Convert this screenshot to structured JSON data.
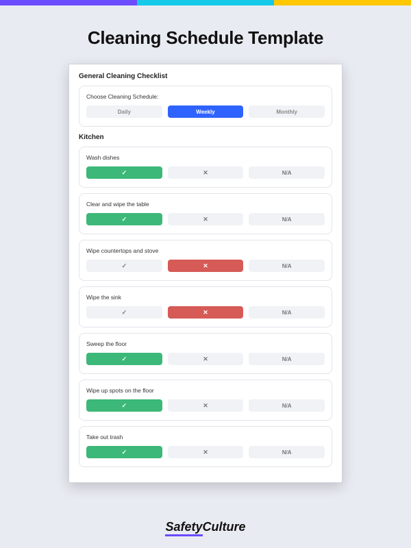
{
  "page": {
    "title": "Cleaning Schedule Template"
  },
  "card": {
    "heading": "General Cleaning Checklist",
    "schedule": {
      "label": "Choose Cleaning Schedule:",
      "options": [
        "Daily",
        "Weekly",
        "Monthly"
      ],
      "selected": "Weekly"
    },
    "section": "Kitchen",
    "option_labels": {
      "check": "✓",
      "cross": "✕",
      "na": "N/A"
    },
    "tasks": [
      {
        "title": "Wash dishes",
        "selected": "check"
      },
      {
        "title": "Clear and wipe the table",
        "selected": "check"
      },
      {
        "title": "Wipe countertops and stove",
        "selected": "cross"
      },
      {
        "title": "Wipe the sink",
        "selected": "cross"
      },
      {
        "title": "Sweep the floor",
        "selected": "check"
      },
      {
        "title": "Wipe up spots on the floor",
        "selected": "check"
      },
      {
        "title": "Take out trash",
        "selected": "check"
      }
    ]
  },
  "footer": {
    "brand_a": "Safety",
    "brand_b": "Culture"
  },
  "colors": {
    "purple": "#6b4cff",
    "cyan": "#15c9e8",
    "yellow": "#ffc700",
    "blue": "#2e63ff",
    "green": "#3cb878",
    "red": "#d65a56",
    "grey_bg": "#e9ebf2"
  }
}
